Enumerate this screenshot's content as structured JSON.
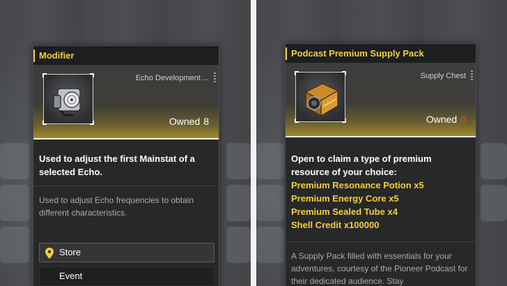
{
  "left_card": {
    "title": "Modifier",
    "category": "Echo Development ...",
    "owned_label": "Owned",
    "owned_count": "8",
    "description": "Used to adjust the first Mainstat of a selected Echo.",
    "lore": "Used to adjust Echo frequencies to obtain different characteristics.",
    "sources": [
      {
        "label": "Store",
        "icon": "location-pin-icon"
      },
      {
        "label": "Event"
      }
    ],
    "item_icon": "modifier-device-icon"
  },
  "right_card": {
    "title": "Podcast Premium Supply Pack",
    "category": "Supply Chest",
    "owned_label": "Owned",
    "owned_count": "0",
    "description": "Open to claim a type of premium resource of your choice:",
    "rewards": [
      "Premium Resonance Potion x5",
      "Premium Energy Core x5",
      "Premium Sealed Tube x4",
      "Shell Credit x100000"
    ],
    "lore": "A Supply Pack filled with essentials for your adventures, courtesy of the Pioneer Podcast for their dedicated audience. Stay",
    "item_icon": "supply-chest-icon"
  },
  "colors": {
    "accent": "#f4cf3c",
    "zero_count": "#e04a3a",
    "card_bg": "#26282a"
  }
}
